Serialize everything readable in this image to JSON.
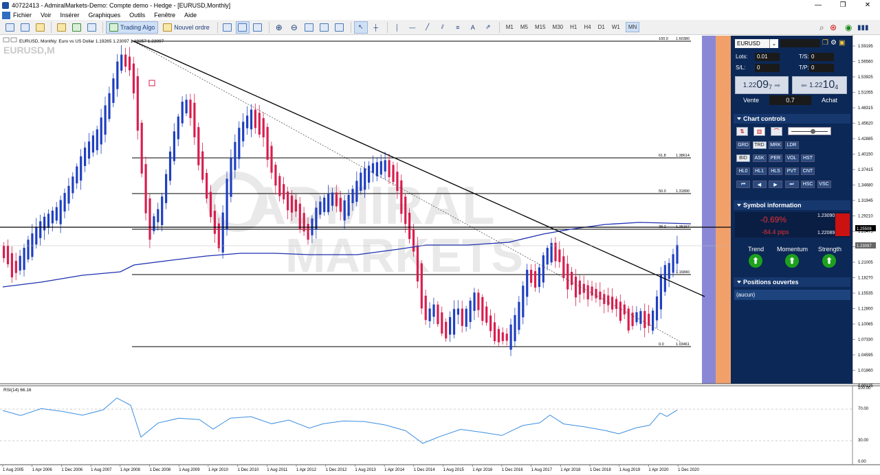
{
  "window": {
    "title": "40722413 - AdmiralMarkets-Demo: Compte demo - Hedge - [EURUSD,Monthly]",
    "controls": [
      "—",
      "❐",
      "✕"
    ]
  },
  "menu": [
    "Fichier",
    "Voir",
    "Insérer",
    "Graphiques",
    "Outils",
    "Fenêtre",
    "Aide"
  ],
  "toolbar": {
    "trading_algo": "Trading Algo",
    "new_order": "Nouvel ordre",
    "timeframes": [
      "M1",
      "M5",
      "M15",
      "M30",
      "H1",
      "H4",
      "D1",
      "W1",
      "MN"
    ],
    "active_timeframe": "MN"
  },
  "chart": {
    "header": "EURUSD, Monthly:  Euro vs US Dollar  1.19265  1.23097  1.19257  1.23097",
    "symbol_watermark": "EURUSD,M",
    "brand_watermark_1": "ADMIRAL",
    "brand_watermark_2": "MARKETS",
    "price_axis": [
      "1.59195",
      "1.56560",
      "1.53925",
      "1.51055",
      "1.48315",
      "1.45620",
      "1.42885",
      "1.40150",
      "1.37415",
      "1.34680",
      "1.31945",
      "1.29210",
      "1.26475",
      "1.23740",
      "1.21005",
      "1.18270",
      "1.15535",
      "1.12800",
      "1.10065",
      "1.07330",
      "1.04595",
      "1.01860",
      "0.99125"
    ],
    "current_price": "1.23097",
    "line_price": "1.25508",
    "time_axis": [
      "1 Aug 2005",
      "1 Apr 2006",
      "1 Dec 2006",
      "1 Aug 2007",
      "1 Apr 2008",
      "1 Dec 2008",
      "1 Aug 2009",
      "1 Apr 2010",
      "1 Dec 2010",
      "1 Aug 2011",
      "1 Apr 2012",
      "1 Dec 2012",
      "1 Aug 2013",
      "1 Apr 2014",
      "1 Dec 2014",
      "1 Aug 2015",
      "1 Apr 2016",
      "1 Dec 2016",
      "1 Aug 2017",
      "1 Apr 2018",
      "1 Dec 2018",
      "1 Aug 2019",
      "1 Apr 2020",
      "1 Dec 2020"
    ],
    "fib_levels": [
      {
        "pct": "100.0",
        "price": "1.60380"
      },
      {
        "pct": "61.8",
        "price": "1.38614"
      },
      {
        "pct": "50.0",
        "price": "1.31890"
      },
      {
        "pct": "38.2",
        "price": "1.25167"
      },
      {
        "pct": "",
        "price": "1.16840"
      },
      {
        "pct": "0.0",
        "price": "1.03461"
      }
    ],
    "rsi_label": "RSI(14) 66.16",
    "rsi_axis": [
      "100.00",
      "70.00",
      "30.00",
      "0.00"
    ],
    "colors": {
      "bull": "#1f3fbf",
      "bear": "#d81e4e",
      "ma": "#1d2fb0",
      "rsi": "#3a8ee0",
      "stripe_blue": "#8a88d6",
      "stripe_orange": "#f2a06a"
    }
  },
  "panel": {
    "symbol": "EURUSD",
    "lots_label": "Lots:",
    "lots_value": "0.01",
    "sl_label": "S/L:",
    "sl_value": "0",
    "ts_label": "T/S:",
    "ts_value": "0",
    "tp_label": "T/P:",
    "tp_value": "0",
    "sell_price_main": "1.22",
    "sell_price_big": "09",
    "sell_price_small": "7",
    "buy_price_main": "1.22",
    "buy_price_big": "10",
    "buy_price_small": "4",
    "sell_label": "Vente",
    "buy_label": "Achat",
    "spread": "0.7",
    "chart_controls_title": "Chart controls",
    "chart_buttons_row1": [
      "GRD",
      "TRD",
      "MRK",
      "LDR"
    ],
    "chart_buttons_row2": [
      "BID",
      "ASK",
      "PER",
      "VOL",
      "HST"
    ],
    "chart_buttons_row3": [
      "HL0",
      "HL1",
      "HLS",
      "PVT",
      "CNT"
    ],
    "chart_buttons_row4": [
      "⏮",
      "◀",
      "▶",
      "⏭",
      "HSC",
      "VSC"
    ],
    "zoom_level": 0.6,
    "symbol_info_title": "Symbol information",
    "change_pct": "-0.69%",
    "change_pips": "-84.4 pips",
    "high": "1.23090",
    "low": "1.22089",
    "trend_label": "Trend",
    "momentum_label": "Momentum",
    "strength_label": "Strength",
    "positions_title": "Positions ouvertes",
    "positions_value": "(aucun)"
  }
}
